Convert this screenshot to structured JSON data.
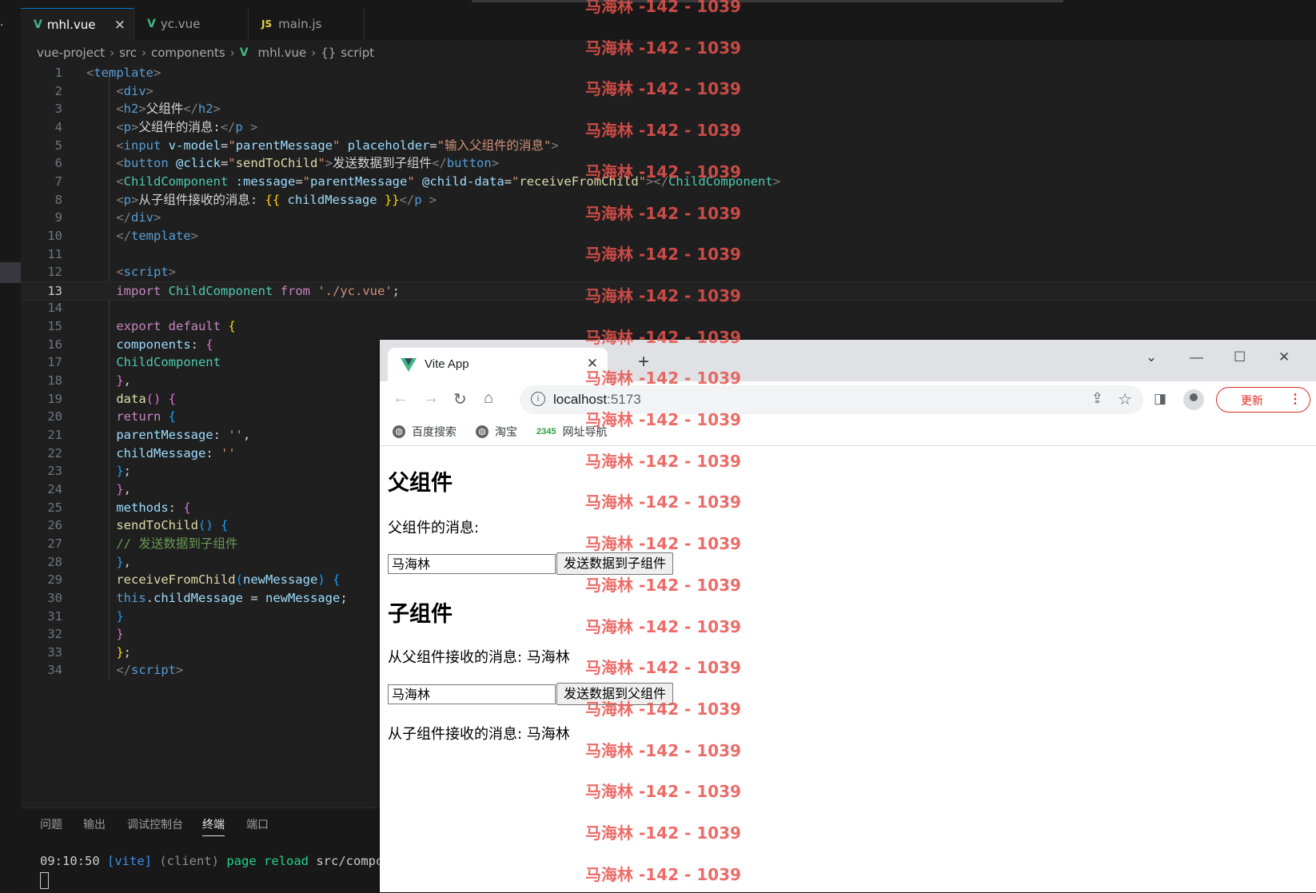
{
  "editor": {
    "tabs": [
      {
        "label": "mhl.vue",
        "icon": "vue-icon"
      },
      {
        "label": "yc.vue",
        "icon": "vue-icon"
      },
      {
        "label": "main.js",
        "icon": "js-icon"
      }
    ],
    "tab_close": "×",
    "breadcrumb": {
      "project": "vue-project",
      "src": "src",
      "components": "components",
      "file": "mhl.vue",
      "symbol": "script"
    },
    "line_numbers": [
      "1",
      "2",
      "3",
      "4",
      "5",
      "6",
      "7",
      "8",
      "9",
      "10",
      "11",
      "12",
      "13",
      "14",
      "15",
      "16",
      "17",
      "18",
      "19",
      "20",
      "21",
      "22",
      "23",
      "24",
      "25",
      "26",
      "27",
      "28",
      "29",
      "30",
      "31",
      "32",
      "33",
      "34"
    ],
    "current_line": 13,
    "code": {
      "template_tag": "template",
      "div_tag": "div",
      "h2_tag": "h2",
      "h2_text": "父组件",
      "p_tag": "p",
      "p1_text": "父组件的消息:",
      "input_tag": "input",
      "vmodel_attr": "v-model",
      "parent_message": "parentMessage",
      "placeholder_attr": "placeholder",
      "placeholder_value": "输入父组件的消息",
      "button_tag": "button",
      "click_attr": "@click",
      "send_to_child": "sendToChild",
      "button_text": "发送数据到子组件",
      "child_component": "ChildComponent",
      "message_attr": ":message",
      "child_data_attr": "@child-data",
      "receive_from_child": "receiveFromChild",
      "p2_text": "从子组件接收的消息: ",
      "child_message": "childMessage",
      "script_tag": "script",
      "import_kw": "import",
      "from_kw": "from",
      "import_path": "'./yc.vue'",
      "export_kw": "export",
      "default_kw": "default",
      "components_key": "components",
      "data_fn": "data",
      "return_kw": "return",
      "empty_str": "''",
      "methods_key": "methods",
      "comment": "// 发送数据到子组件",
      "new_message": "newMessage",
      "this_kw": "this"
    }
  },
  "panel": {
    "tabs": [
      "问题",
      "输出",
      "调试控制台",
      "终端",
      "端口"
    ],
    "active_tab": "终端",
    "terminal": {
      "time": "09:10:50",
      "tag": "[vite]",
      "client": "(client)",
      "action": "page reload",
      "path": "src/compon"
    }
  },
  "browser": {
    "tab_title": "Vite App",
    "url_host": "localhost",
    "url_port": ":5173",
    "update_label": "更新",
    "bookmarks": [
      "百度搜索",
      "淘宝",
      "网址导航"
    ],
    "bookmark_2345": "2345",
    "page": {
      "parent_heading": "父组件",
      "parent_label": "父组件的消息:",
      "parent_input_value": "马海林",
      "send_child_button": "发送数据到子组件",
      "child_heading": "子组件",
      "child_received": "从父组件接收的消息: 马海林",
      "child_input_value": "马海林",
      "send_parent_button": "发送数据到父组件",
      "parent_received": "从子组件接收的消息: 马海林"
    }
  },
  "watermark": "马海林 -142 - 1039",
  "colors": {
    "accent": "#0078d4",
    "vue_green": "#41b883",
    "update_red": "#d93025",
    "watermark_red": "#e8534e"
  }
}
